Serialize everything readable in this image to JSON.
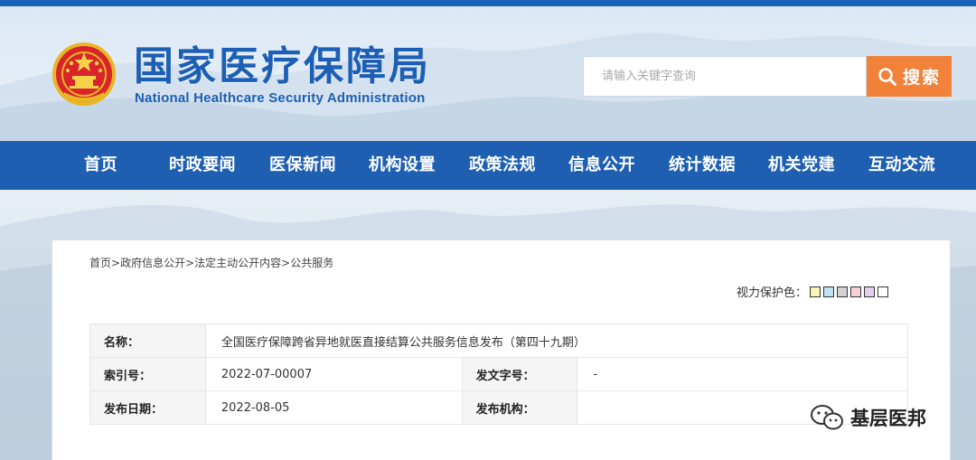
{
  "header": {
    "title": "国家医疗保障局",
    "subtitle": "National Healthcare Security Administration",
    "emblem_icon": "national-emblem-icon"
  },
  "search": {
    "placeholder": "请输入关键字查询",
    "button_label": "搜索",
    "icon": "search-icon"
  },
  "nav": {
    "items": [
      "首页",
      "时政要闻",
      "医保新闻",
      "机构设置",
      "政策法规",
      "信息公开",
      "统计数据",
      "机关党建",
      "互动交流"
    ]
  },
  "breadcrumb": {
    "items": [
      "首页",
      "政府信息公开",
      "法定主动公开内容",
      "公共服务"
    ],
    "separator": ">"
  },
  "vision": {
    "label": "视力保护色：",
    "swatches": [
      "#fbf2b6",
      "#bfe3f4",
      "#d2d2d2",
      "#f4d1d7",
      "#e3d0f0",
      "#ffffff"
    ]
  },
  "info": {
    "name_label": "名称：",
    "name_value": "全国医疗保障跨省异地就医直接结算公共服务信息发布（第四十九期）",
    "index_label": "索引号：",
    "index_value": "2022-07-00007",
    "docno_label": "发文字号：",
    "docno_value": "-",
    "date_label": "发布日期：",
    "date_value": "2022-08-05",
    "org_label": "发布机构：",
    "org_value": ""
  },
  "watermark": {
    "text": "基层医邦",
    "icon": "wechat-icon"
  },
  "colors": {
    "brand_blue": "#1e5fb2",
    "search_orange": "#f2813a"
  }
}
